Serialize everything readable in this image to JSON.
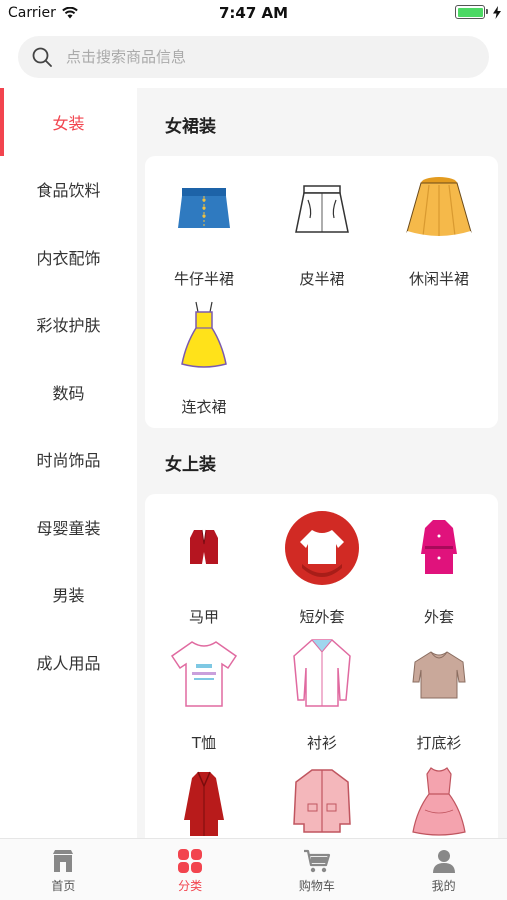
{
  "status_bar": {
    "carrier": "Carrier",
    "time": "7:47 AM"
  },
  "search": {
    "placeholder": "点击搜索商品信息"
  },
  "sidebar": {
    "items": [
      {
        "label": "女装",
        "active": true
      },
      {
        "label": "食品饮料"
      },
      {
        "label": "内衣配饰"
      },
      {
        "label": "彩妆护肤"
      },
      {
        "label": "数码"
      },
      {
        "label": "时尚饰品"
      },
      {
        "label": "母婴童装"
      },
      {
        "label": "男装"
      },
      {
        "label": "成人用品"
      }
    ]
  },
  "sections": [
    {
      "title": "女裙装",
      "items": [
        {
          "label": "牛仔半裙",
          "icon": "denim-skirt-icon"
        },
        {
          "label": "皮半裙",
          "icon": "leather-skirt-icon"
        },
        {
          "label": "休闲半裙",
          "icon": "casual-skirt-icon"
        },
        {
          "label": "连衣裙",
          "icon": "dress-icon"
        }
      ]
    },
    {
      "title": "女上装",
      "items": [
        {
          "label": "马甲",
          "icon": "vest-icon"
        },
        {
          "label": "短外套",
          "icon": "short-jacket-icon"
        },
        {
          "label": "外套",
          "icon": "coat-icon"
        },
        {
          "label": "T恤",
          "icon": "tshirt-icon"
        },
        {
          "label": "衬衫",
          "icon": "shirt-icon"
        },
        {
          "label": "打底衫",
          "icon": "base-layer-icon"
        },
        {
          "label": "",
          "icon": "red-coat-icon"
        },
        {
          "label": "",
          "icon": "pink-jacket-icon"
        },
        {
          "label": "",
          "icon": "pink-dress-icon"
        }
      ]
    }
  ],
  "tabbar": {
    "items": [
      {
        "label": "首页",
        "icon": "home-icon"
      },
      {
        "label": "分类",
        "icon": "category-icon",
        "active": true
      },
      {
        "label": "购物车",
        "icon": "cart-icon"
      },
      {
        "label": "我的",
        "icon": "user-icon"
      }
    ]
  },
  "colors": {
    "accent": "#f2444e",
    "background": "#f5f5f5"
  }
}
